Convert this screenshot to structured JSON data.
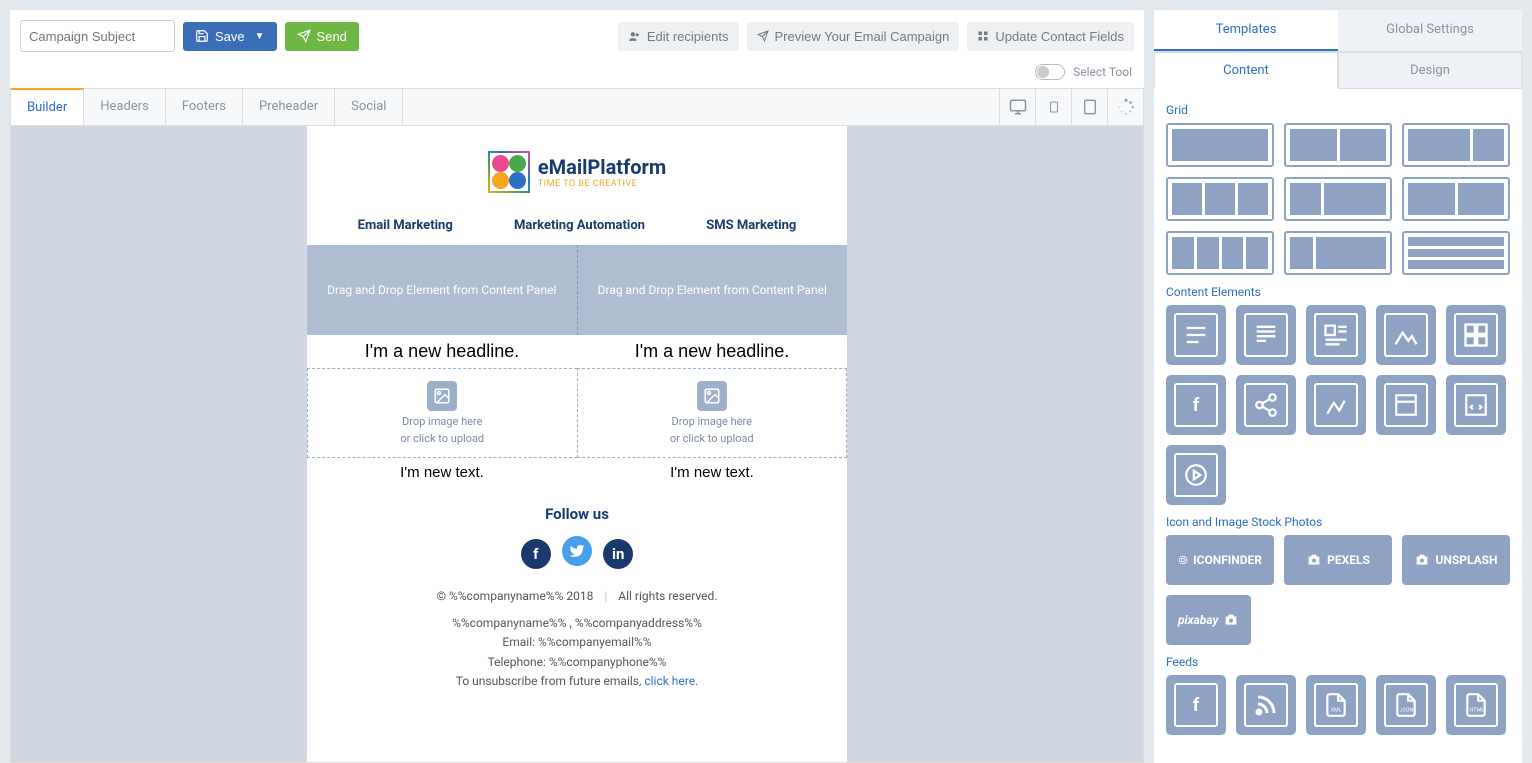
{
  "toolbar": {
    "subject_placeholder": "Campaign Subject",
    "save_label": "Save",
    "send_label": "Send",
    "edit_recipients": "Edit recipients",
    "preview": "Preview Your Email Campaign",
    "update_fields": "Update Contact Fields",
    "select_tool": "Select Tool"
  },
  "tabs": {
    "builder": "Builder",
    "headers": "Headers",
    "footers": "Footers",
    "preheader": "Preheader",
    "social": "Social"
  },
  "email": {
    "logo_title": "eMailPlatform",
    "logo_sub": "TIME TO BE CREATIVE",
    "nav1": "Email Marketing",
    "nav2": "Marketing Automation",
    "nav3": "SMS Marketing",
    "dropzone": "Drag and Drop Element from Content Panel",
    "headline": "I'm a new headline.",
    "drop_img_1": "Drop image here",
    "drop_img_2": "or click to upload",
    "new_text": "I'm new text.",
    "follow": "Follow us",
    "copyright": "© %%companyname%% 2018",
    "rights": "All rights reserved.",
    "company_line": "%%companyname%% , %%companyaddress%%",
    "email_line": "Email: %%companyemail%%",
    "phone_line": "Telephone: %%companyphone%%",
    "unsub_prefix": "To unsubscribe from future emails, ",
    "unsub_link": "click here"
  },
  "right": {
    "templates": "Templates",
    "global": "Global Settings",
    "content": "Content",
    "design": "Design",
    "grid": "Grid",
    "content_elements": "Content Elements",
    "stock": "Icon and Image Stock Photos",
    "feeds": "Feeds",
    "iconfinder": "ICONFINDER",
    "pexels": "PEXELS",
    "unsplash": "UNSPLASH",
    "pixabay": "pixabay"
  }
}
